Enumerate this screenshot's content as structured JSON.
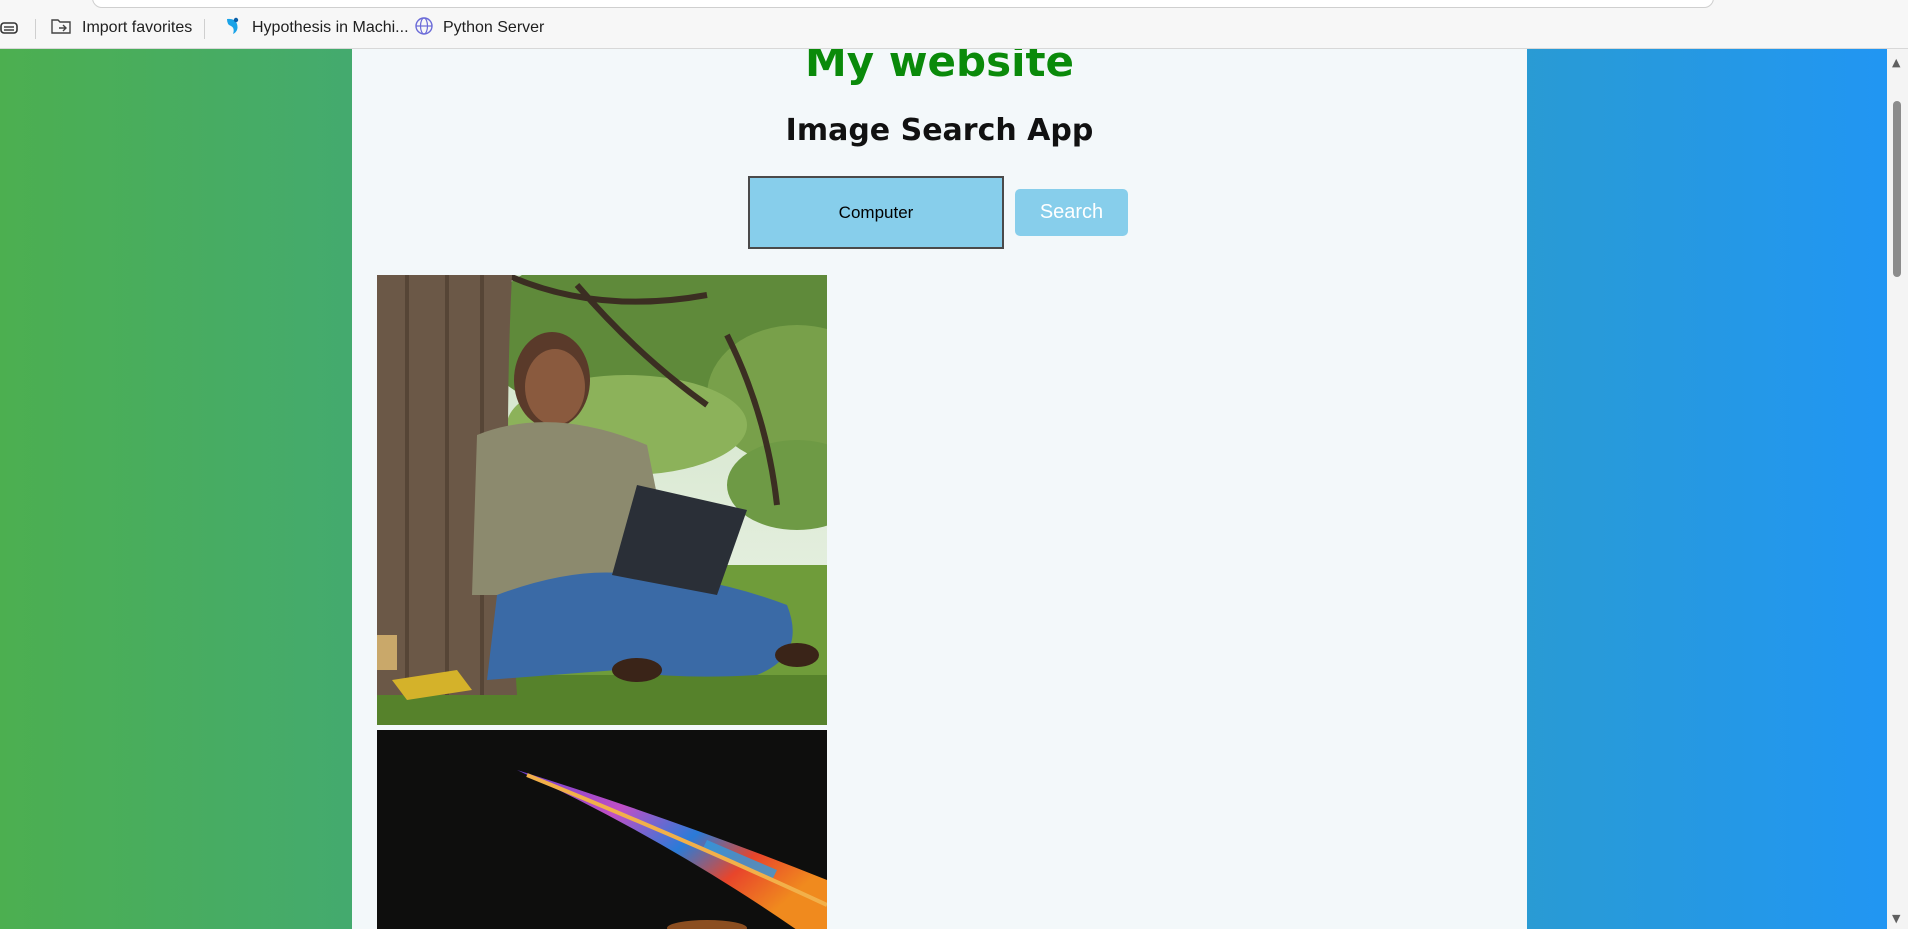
{
  "browser": {
    "bookmarks": [
      {
        "label": "Import favorites",
        "icon": "import-favorites-icon"
      },
      {
        "label": "Hypothesis in Machi...",
        "icon": "hypothesis-favicon"
      },
      {
        "label": "Python Server",
        "icon": "globe-icon"
      }
    ]
  },
  "page": {
    "site_title": "My website",
    "app_title": "Image Search App",
    "search": {
      "value": "Computer"
    },
    "search_button_label": "Search",
    "results": [
      {
        "description": "woman-sitting-under-tree-with-laptop"
      },
      {
        "description": "laptop-rainbow-light-dark-background"
      }
    ]
  },
  "colors": {
    "site_title": "#0a8a0a",
    "input_bg": "#87ceeb",
    "gradient_left": "#4caf50",
    "gradient_right": "#2196f3"
  }
}
